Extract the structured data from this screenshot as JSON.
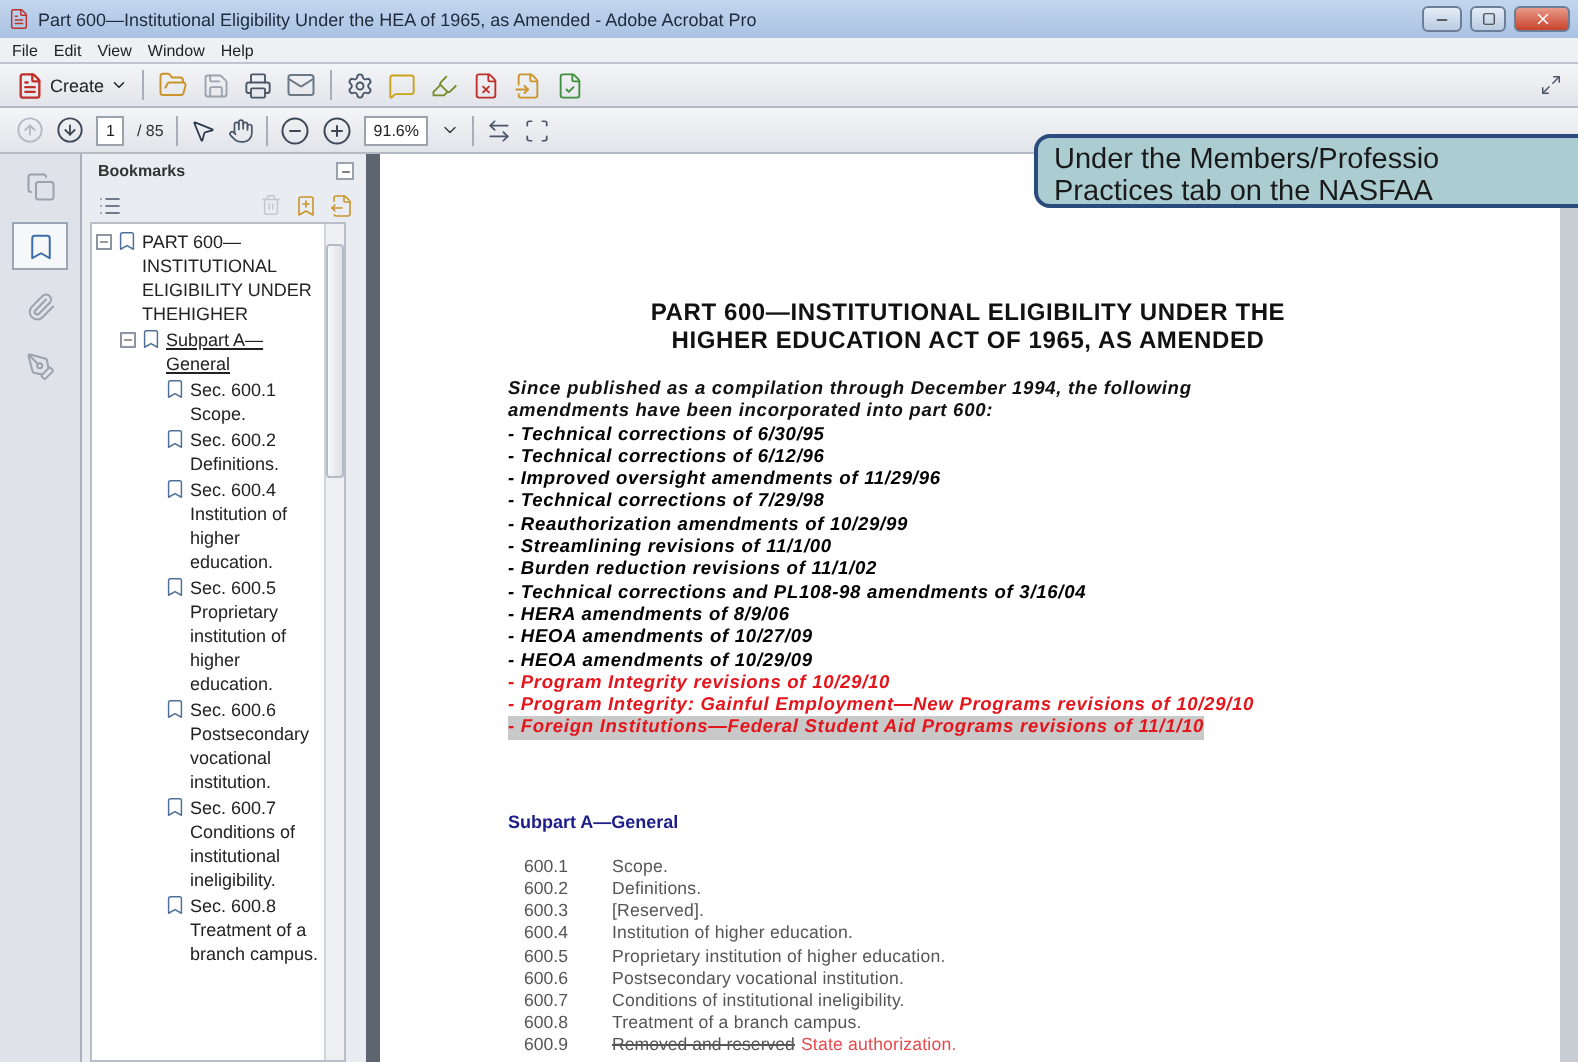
{
  "window": {
    "title": "Part 600—Institutional Eligibility Under the HEA of 1965, as Amended - Adobe Acrobat Pro"
  },
  "menu": [
    "File",
    "Edit",
    "View",
    "Window",
    "Help"
  ],
  "toolbar": {
    "create_label": "Create",
    "page_number": "1",
    "page_count": "/ 85",
    "zoom": "91.6%"
  },
  "nav_panel": [
    {
      "kind": "pages",
      "selected": false
    },
    {
      "kind": "bookmarks",
      "selected": true
    },
    {
      "kind": "attachments",
      "selected": false
    },
    {
      "kind": "signatures",
      "selected": false
    }
  ],
  "bookmarks": {
    "title": "Bookmarks",
    "items": [
      {
        "label": "PART 600—INSTITUTIONAL ELIGIBILITY UNDER THEHIGHER",
        "expanded": true,
        "selected": false,
        "children": [
          {
            "label": "Subpart A—General",
            "expanded": true,
            "selected": true,
            "children": [
              {
                "label": "Sec. 600.1 Scope.",
                "selected": false
              },
              {
                "label": "Sec. 600.2 Definitions.",
                "selected": false
              },
              {
                "label": "Sec. 600.4 Institution of higher education.",
                "selected": false
              },
              {
                "label": "Sec. 600.5 Proprietary institution of higher education.",
                "selected": false
              },
              {
                "label": "Sec. 600.6 Postsecondary vocational institution.",
                "selected": false
              },
              {
                "label": "Sec. 600.7 Conditions of institutional ineligibility.",
                "selected": false
              },
              {
                "label": "Sec. 600.8 Treatment of a branch campus.",
                "selected": false
              }
            ]
          }
        ]
      }
    ]
  },
  "document": {
    "title": [
      "PART 600—INSTITUTIONAL ELIGIBILITY UNDER THE",
      "HIGHER EDUCATION ACT OF 1965, AS AMENDED"
    ],
    "intro": "Since published as a compilation through December 1994, the following amendments have been incorporated into part 600:",
    "amendments": [
      {
        "text": "- Technical corrections of 6/30/95",
        "color": "#000000",
        "highlighted": false
      },
      {
        "text": "- Technical corrections of 6/12/96",
        "color": "#000000",
        "highlighted": false
      },
      {
        "text": "- Improved oversight amendments of 11/29/96",
        "color": "#000000",
        "highlighted": false
      },
      {
        "text": "- Technical corrections of 7/29/98",
        "color": "#000000",
        "highlighted": false
      },
      {
        "text": "- Reauthorization amendments of 10/29/99",
        "color": "#000000",
        "highlighted": false
      },
      {
        "text": "- Streamlining revisions of 11/1/00",
        "color": "#000000",
        "highlighted": false
      },
      {
        "text": "- Burden reduction revisions of 11/1/02",
        "color": "#000000",
        "highlighted": false
      },
      {
        "text": "- Technical corrections and PL108-98 amendments of 3/16/04",
        "color": "#000000",
        "highlighted": false
      },
      {
        "text": "- HERA amendments of 8/9/06",
        "color": "#000000",
        "highlighted": false
      },
      {
        "text": "- HEOA amendments of 10/27/09",
        "color": "#000000",
        "highlighted": false
      },
      {
        "text": "- HEOA amendments of 10/29/09",
        "color": "#000000",
        "highlighted": false
      },
      {
        "text": "- Program Integrity revisions of 10/29/10",
        "color": "#e3161d",
        "highlighted": false
      },
      {
        "text": "- Program Integrity: Gainful Employment—New Programs revisions of 10/29/10",
        "color": "#e3161d",
        "highlighted": false
      },
      {
        "text": "- Foreign Institutions—Federal Student Aid Programs revisions of 11/1/10",
        "color": "#e3161d",
        "highlighted": true
      }
    ],
    "subpart_heading": "Subpart A—General",
    "sections": [
      {
        "number": "600.1",
        "kind": "plain",
        "title": "Scope."
      },
      {
        "number": "600.2",
        "kind": "plain",
        "title": "Definitions."
      },
      {
        "number": "600.3",
        "kind": "plain",
        "title": "[Reserved]."
      },
      {
        "number": "600.4",
        "kind": "plain",
        "title": "Institution of higher education."
      },
      {
        "number": "600.5",
        "kind": "plain",
        "title": "Proprietary institution of higher education."
      },
      {
        "number": "600.6",
        "kind": "plain",
        "title": "Postsecondary vocational institution."
      },
      {
        "number": "600.7",
        "kind": "plain",
        "title": "Conditions of institutional ineligibility."
      },
      {
        "number": "600.8",
        "kind": "plain",
        "title": "Treatment of a branch campus."
      },
      {
        "number": "600.9",
        "kind": "amended",
        "struck": "Removed and reserved",
        "title": "State authorization."
      }
    ]
  },
  "callout": {
    "lines": [
      "Under the Members/Professio",
      "Practices tab on the NASFAA"
    ]
  }
}
